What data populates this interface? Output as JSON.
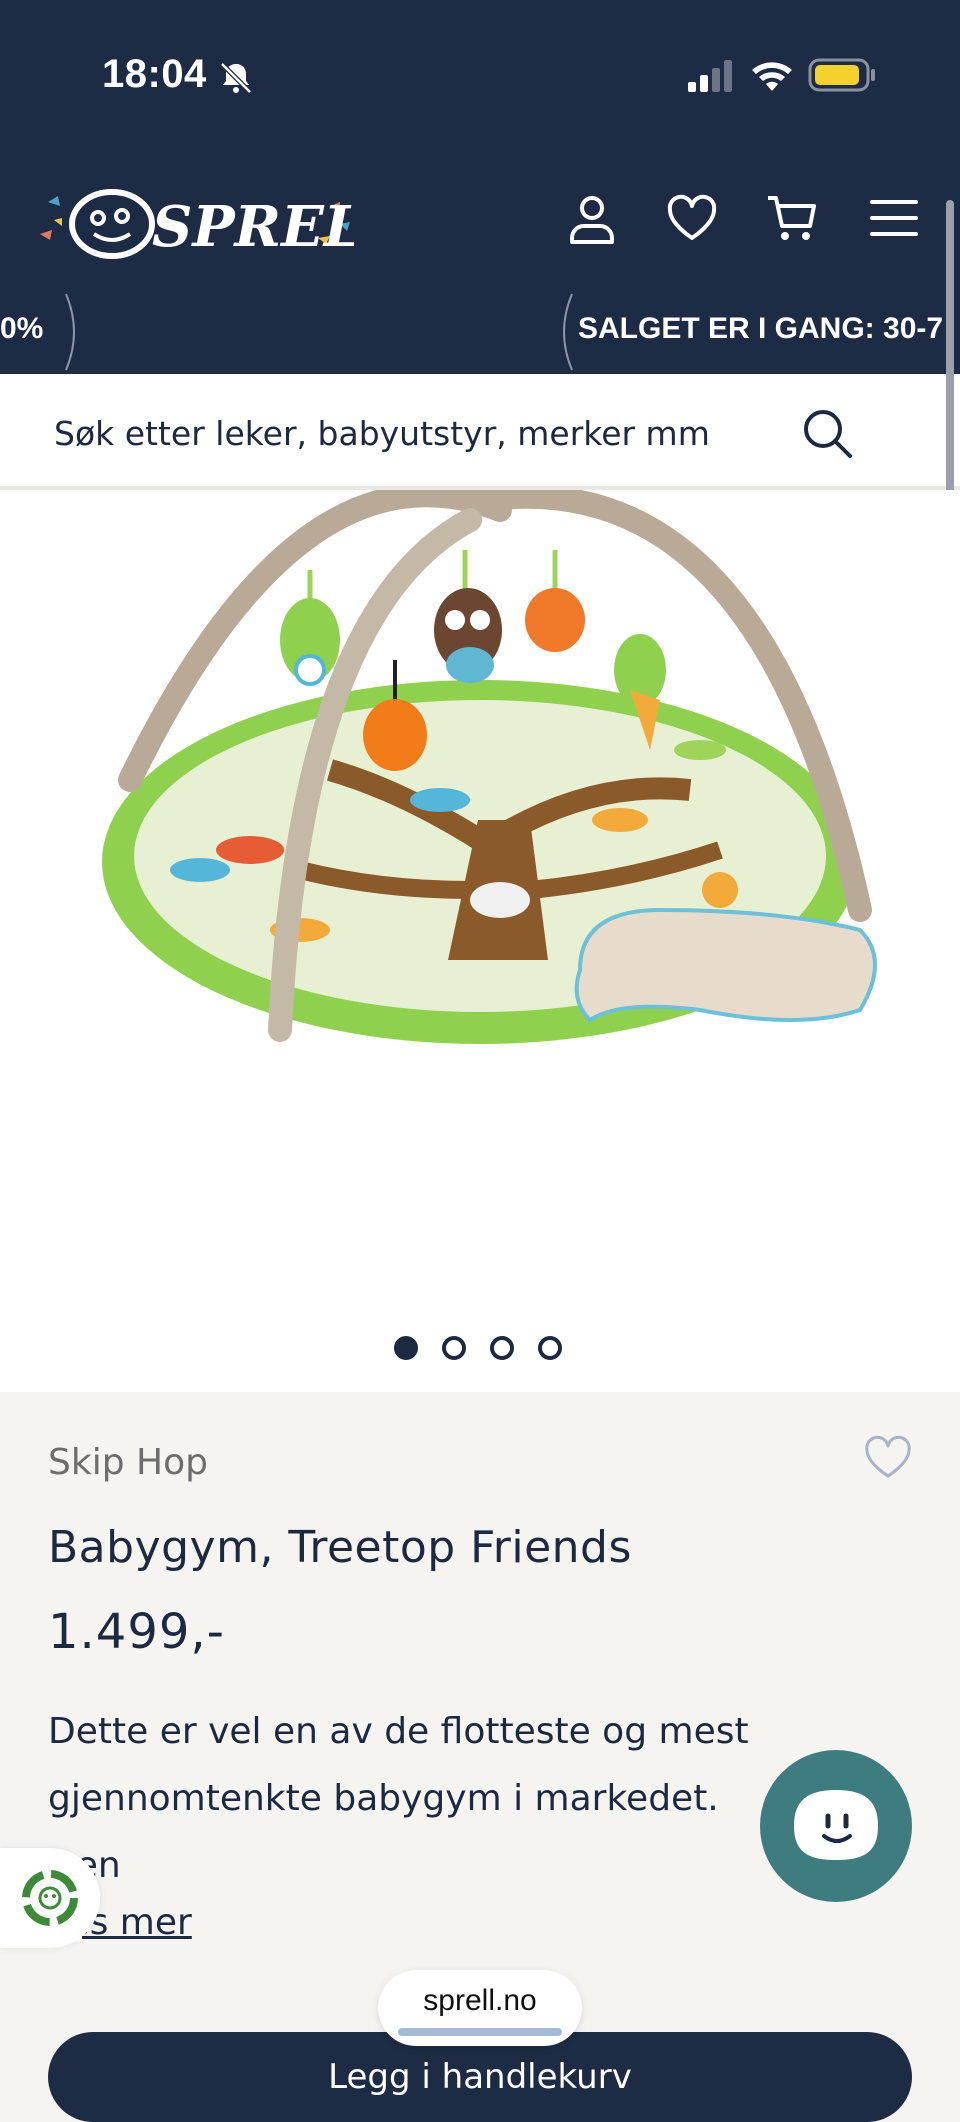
{
  "status_bar": {
    "time": "18:04",
    "icons": [
      "bell-slash-icon",
      "cellular-signal-icon",
      "wifi-icon",
      "battery-icon"
    ]
  },
  "header": {
    "logo_text": "SPRELL",
    "icons": [
      "account-icon",
      "heart-icon",
      "cart-icon",
      "menu-icon"
    ]
  },
  "promo": {
    "left_text": "0%",
    "right_text": "SALGET ER I GANG: 30-7"
  },
  "search": {
    "placeholder": "Søk etter leker, babyutstyr, merker mm"
  },
  "gallery": {
    "image_count": 4,
    "active_index": 0
  },
  "product": {
    "brand": "Skip Hop",
    "title": "Babygym, Treetop Friends",
    "price": "1.499,-",
    "description": "Dette er vel en av de flotteste og mest gjennomtenkte babygym i markedet. Den",
    "read_more": "Les mer",
    "add_to_cart": "Legg i handlekurv"
  },
  "browser": {
    "url": "sprell.no"
  },
  "colors": {
    "navy": "#1d2b44",
    "chat": "#3f7c80"
  }
}
